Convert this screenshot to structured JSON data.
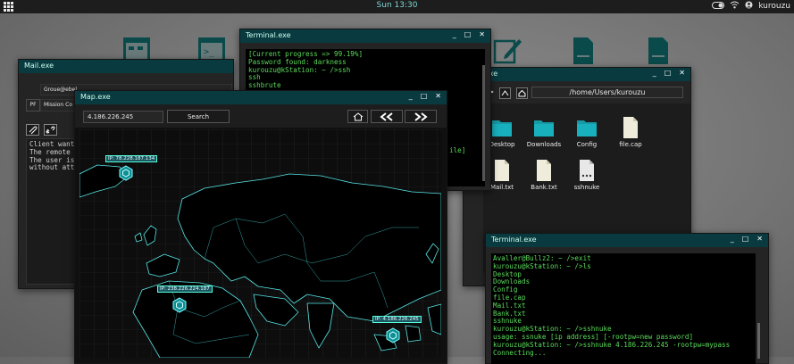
{
  "topbar": {
    "clock": "Sun 13:30",
    "user": "kurouzu"
  },
  "mail": {
    "title": "Mail.exe",
    "from": "Groue@ebel",
    "pf": "PF",
    "subject": "Mission Co",
    "body": [
      "Client wants",
      "The remote i",
      "The user is",
      "without attr"
    ]
  },
  "terminal1": {
    "title": "Terminal.exe",
    "lines": [
      "[Current progress => 99.19%]",
      "Password found: darkness",
      "kurouzu@kStation: ~ />ssh",
      "ssh",
      "sshbrute"
    ],
    "tail": "ile]"
  },
  "explorer": {
    "title": "orer.exe",
    "path": "/home/Users/kurouzu",
    "items": [
      {
        "label": "Desktop",
        "icon": "folder-icon"
      },
      {
        "label": "Downloads",
        "icon": "folder-icon"
      },
      {
        "label": "Config",
        "icon": "folder-icon"
      },
      {
        "label": "file.cap",
        "icon": "file-icon"
      },
      {
        "label": "Mail.txt",
        "icon": "file-icon"
      },
      {
        "label": "Bank.txt",
        "icon": "file-icon"
      },
      {
        "label": "sshnuke",
        "icon": "exec-file-icon"
      }
    ]
  },
  "map": {
    "title": "Map.exe",
    "ip_value": "4.186.226.245",
    "search_label": "Search",
    "markers": [
      "IP: 78.228.187.134",
      "IP: 238.226.224.187",
      "IP: 4.186.226.245"
    ]
  },
  "terminal2": {
    "title": "Terminal.exe",
    "lines": [
      "Avaller@Bullz2: ~ />exit",
      "kurouzu@kStation: ~ />ls",
      "Desktop",
      "Downloads",
      "Config",
      "file.cap",
      "Mail.txt",
      "Bank.txt",
      "sshnuke",
      "kurouzu@kStation: ~ />sshnuke",
      "usage: ssnuke [ip address] [-rootpw=new password]",
      "kurouzu@kStation: ~ />sshnuke 4.186.226.245 -rootpw=mypass",
      "Connecting..."
    ]
  },
  "window_controls": {
    "minimize": "_",
    "maximize": "□",
    "close": "✕"
  },
  "colors": {
    "accent": "#0e8f99",
    "titlebar": "#083a40",
    "terminal_text": "#5bdc5b"
  }
}
